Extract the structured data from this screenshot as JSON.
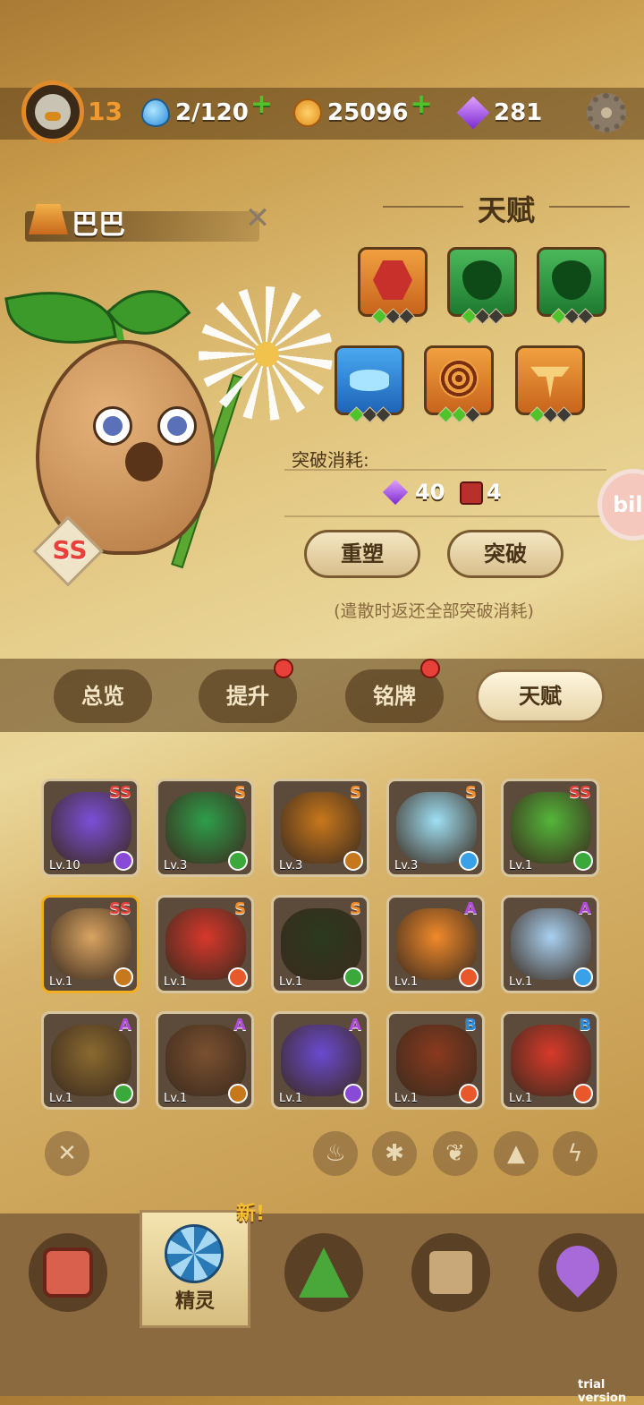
{
  "header": {
    "player_level": "13",
    "stamina": "2/120",
    "coins": "25096",
    "gems": "281",
    "plus": "+"
  },
  "pet": {
    "name": "巴巴",
    "rank": "SS",
    "close": "✕"
  },
  "talent": {
    "title": "天赋",
    "breakthrough_label": "突破消耗:",
    "cost_gems": "40",
    "cost_books": "4",
    "reshape_label": "重塑",
    "breakthrough_button": "突破",
    "hint": "(遣散时返还全部突破消耗)",
    "slots": [
      {
        "icon": "hex-gem-icon",
        "filled": 1
      },
      {
        "icon": "green-drop-icon",
        "filled": 1
      },
      {
        "icon": "green-drop-icon",
        "filled": 1
      },
      {
        "icon": "eye-icon",
        "filled": 1
      },
      {
        "icon": "swirl-icon",
        "filled": 2
      },
      {
        "icon": "wings-icon",
        "filled": 1
      }
    ]
  },
  "watermark": "bili",
  "tabs": [
    {
      "label": "总览",
      "dot": false,
      "active": false
    },
    {
      "label": "提升",
      "dot": true,
      "active": false
    },
    {
      "label": "铭牌",
      "dot": true,
      "active": false
    },
    {
      "label": "天赋",
      "dot": false,
      "active": true
    }
  ],
  "pets": [
    {
      "rank": "SS",
      "level": "Lv.10",
      "element": "lightning-icon",
      "color": "#7c4fd8"
    },
    {
      "rank": "S",
      "level": "Lv.3",
      "element": "leaf-icon",
      "color": "#2e9e4a"
    },
    {
      "rank": "S",
      "level": "Lv.3",
      "element": "earth-icon",
      "color": "#c8781c"
    },
    {
      "rank": "S",
      "level": "Lv.3",
      "element": "ice-icon",
      "color": "#9ee0f4"
    },
    {
      "rank": "SS",
      "level": "Lv.1",
      "element": "leaf-icon",
      "color": "#54b63a"
    },
    {
      "rank": "SS",
      "level": "Lv.1",
      "element": "earth-icon",
      "color": "#d9a462"
    },
    {
      "rank": "S",
      "level": "Lv.1",
      "element": "fire-icon",
      "color": "#d8382c"
    },
    {
      "rank": "S",
      "level": "Lv.1",
      "element": "leaf-icon",
      "color": "#2b3a1e"
    },
    {
      "rank": "A",
      "level": "Lv.1",
      "element": "fire-icon",
      "color": "#f08a2a"
    },
    {
      "rank": "A",
      "level": "Lv.1",
      "element": "ice-icon",
      "color": "#a8d0f0"
    },
    {
      "rank": "A",
      "level": "Lv.1",
      "element": "leaf-icon",
      "color": "#8a6a30"
    },
    {
      "rank": "A",
      "level": "Lv.1",
      "element": "earth-icon",
      "color": "#7a5030"
    },
    {
      "rank": "A",
      "level": "Lv.1",
      "element": "lightning-icon",
      "color": "#6a4ad0"
    },
    {
      "rank": "B",
      "level": "Lv.1",
      "element": "fire-icon",
      "color": "#8a3a1e"
    },
    {
      "rank": "B",
      "level": "Lv.1",
      "element": "fire-icon",
      "color": "#d83a2a"
    }
  ],
  "filters": [
    "fire-icon",
    "ice-icon",
    "leaf-icon",
    "earth-icon",
    "lightning-icon"
  ],
  "nav": {
    "active_label": "精灵",
    "new_tag": "新!",
    "items": [
      "backpack-icon",
      "spirit-icon",
      "mountain-icon",
      "chest-icon",
      "map-pin-icon"
    ]
  },
  "footer": "trial version",
  "colors": {
    "rank_SS": "#e8413a",
    "rank_S": "#f08a2a",
    "rank_A": "#b04ad8",
    "rank_B": "#2a8ae0",
    "fire": "#e8582a",
    "ice": "#3aa0e8",
    "leaf": "#3aa83a",
    "earth": "#c8781c",
    "lightning": "#8a4ad8"
  }
}
